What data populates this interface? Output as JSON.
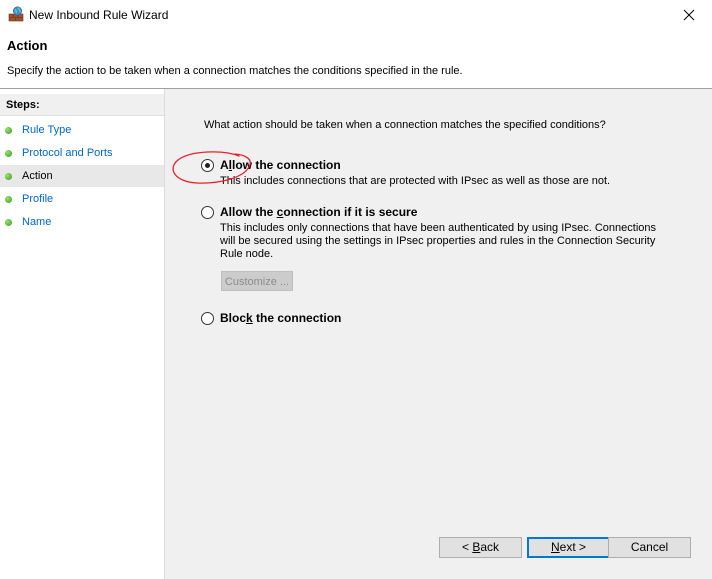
{
  "window": {
    "title": "New Inbound Rule Wizard",
    "app_icon": "firewall-wizard-icon",
    "close_icon": "close-icon"
  },
  "header": {
    "title": "Action",
    "subtitle": "Specify the action to be taken when a connection matches the conditions specified in the rule."
  },
  "steps": {
    "heading": "Steps:",
    "items": [
      {
        "label": "Rule Type",
        "active": false
      },
      {
        "label": "Protocol and Ports",
        "active": false
      },
      {
        "label": "Action",
        "active": true
      },
      {
        "label": "Profile",
        "active": false
      },
      {
        "label": "Name",
        "active": false
      }
    ]
  },
  "main": {
    "question": "What action should be taken when a connection matches the specified conditions?",
    "options": [
      {
        "label_pre": "A",
        "label_ul": "l",
        "label_post": "low the connection",
        "desc": "This includes connections that are protected with IPsec as well as those are not.",
        "checked": true
      },
      {
        "label_pre": "Allow the ",
        "label_ul": "c",
        "label_post": "onnection if it is secure",
        "desc": "This includes only connections that have been authenticated by using IPsec.  Connections will be secured using the settings in IPsec properties and rules in the Connection Security Rule node.",
        "checked": false
      },
      {
        "label_pre": "Bloc",
        "label_ul": "k",
        "label_post": " the connection",
        "desc": "",
        "checked": false
      }
    ],
    "customize_label": "Customize ..."
  },
  "footer": {
    "back_pre": "< ",
    "back_ul": "B",
    "back_post": "ack",
    "next_ul": "N",
    "next_post": "ext >",
    "cancel_label": "Cancel"
  },
  "colors": {
    "step_link": "#0066cc",
    "annotation": "#e8202a",
    "default_button_border": "#0078d7"
  }
}
